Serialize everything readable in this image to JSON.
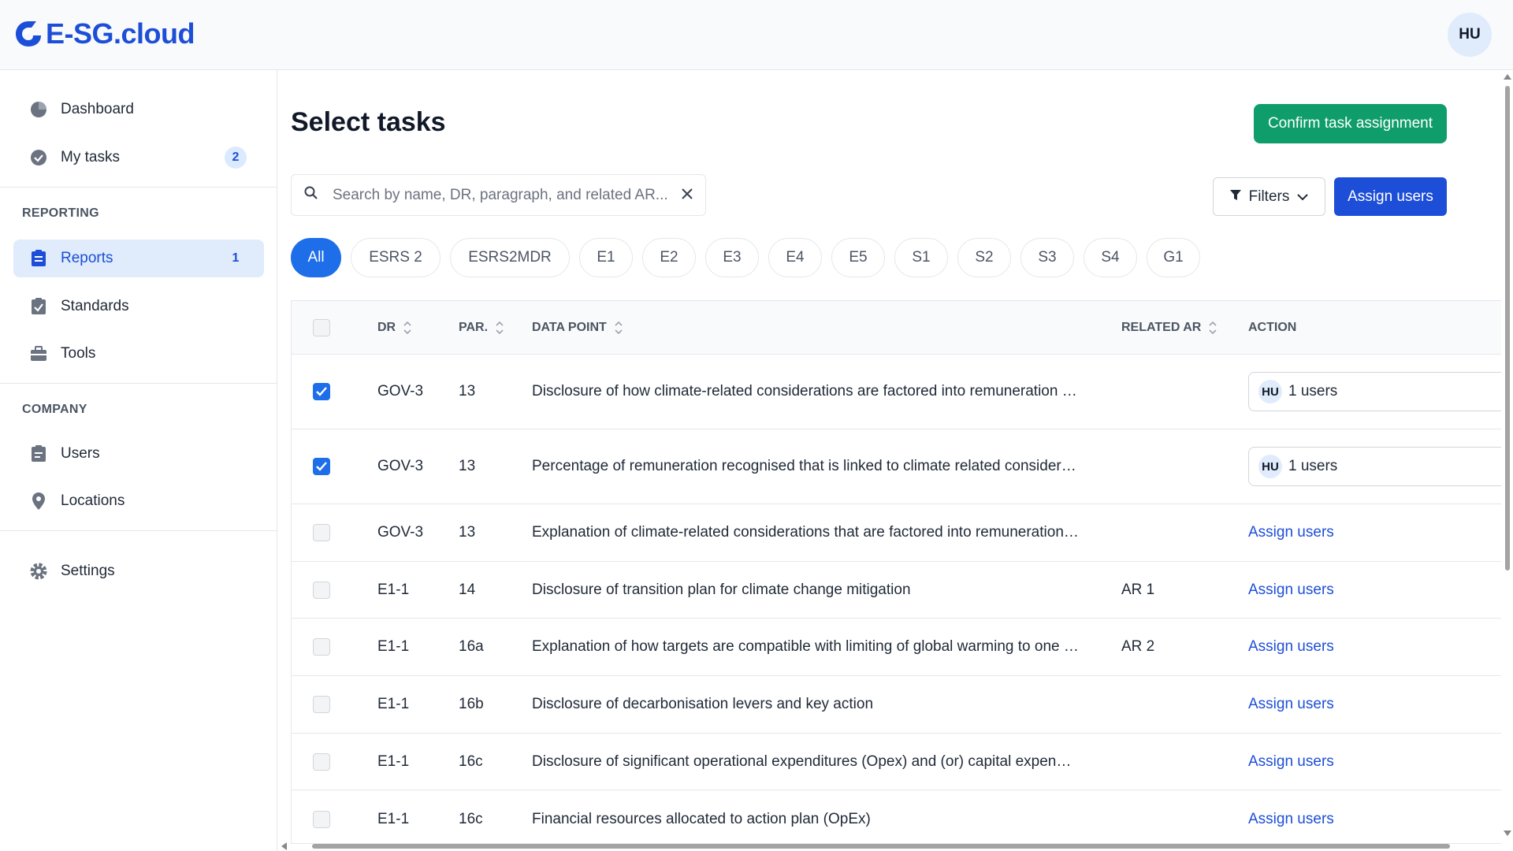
{
  "header": {
    "logo_text": "E-SG.cloud",
    "avatar_initials": "HU"
  },
  "sidebar": {
    "items": [
      {
        "label": "Dashboard",
        "icon": "pie-chart-icon"
      },
      {
        "label": "My tasks",
        "icon": "check-circle-icon",
        "badge": "2"
      }
    ],
    "reporting_title": "REPORTING",
    "reporting_items": [
      {
        "label": "Reports",
        "icon": "clipboard-icon",
        "badge": "1",
        "active": true
      },
      {
        "label": "Standards",
        "icon": "clipboard-check-icon"
      },
      {
        "label": "Tools",
        "icon": "briefcase-icon"
      }
    ],
    "company_title": "COMPANY",
    "company_items": [
      {
        "label": "Users",
        "icon": "user-list-icon"
      },
      {
        "label": "Locations",
        "icon": "map-pin-icon"
      }
    ],
    "settings_label": "Settings"
  },
  "main": {
    "title": "Select tasks",
    "confirm_button": "Confirm task assignment",
    "search_placeholder": "Search by name, DR, paragraph, and related AR...",
    "filters_button": "Filters",
    "assign_users_button": "Assign users",
    "chips": [
      "All",
      "ESRS 2",
      "ESRS2MDR",
      "E1",
      "E2",
      "E3",
      "E4",
      "E5",
      "S1",
      "S2",
      "S3",
      "S4",
      "G1"
    ],
    "active_chip": "All"
  },
  "table": {
    "columns": {
      "dr": "DR",
      "par": "PAR.",
      "data_point": "DATA POINT",
      "related_ar": "RELATED AR",
      "action": "ACTION"
    },
    "rows": [
      {
        "checked": true,
        "dr": "GOV-3",
        "par": "13",
        "data_point": "Disclosure of how climate-related considerations are factored into remuneration …",
        "related_ar": "",
        "action": "1 users",
        "action_type": "select"
      },
      {
        "checked": true,
        "dr": "GOV-3",
        "par": "13",
        "data_point": "Percentage of remuneration recognised that is linked to climate related consider…",
        "related_ar": "",
        "action": "1 users",
        "action_type": "select"
      },
      {
        "checked": false,
        "dr": "GOV-3",
        "par": "13",
        "data_point": "Explanation of climate-related considerations that are factored into remuneration…",
        "related_ar": "",
        "action": "Assign users",
        "action_type": "link"
      },
      {
        "checked": false,
        "dr": "E1-1",
        "par": "14",
        "data_point": "Disclosure of transition plan for climate change mitigation",
        "related_ar": "AR 1",
        "action": "Assign users",
        "action_type": "link"
      },
      {
        "checked": false,
        "dr": "E1-1",
        "par": "16a",
        "data_point": "Explanation of how targets are compatible with limiting of global warming to one …",
        "related_ar": "AR 2",
        "action": "Assign users",
        "action_type": "link"
      },
      {
        "checked": false,
        "dr": "E1-1",
        "par": "16b",
        "data_point": "Disclosure of decarbonisation levers and key action",
        "related_ar": "",
        "action": "Assign users",
        "action_type": "link"
      },
      {
        "checked": false,
        "dr": "E1-1",
        "par": "16c",
        "data_point": "Disclosure of significant operational expenditures (Opex) and (or) capital expen…",
        "related_ar": "",
        "action": "Assign users",
        "action_type": "link"
      },
      {
        "checked": false,
        "dr": "E1-1",
        "par": "16c",
        "data_point": "Financial resources allocated to action plan (OpEx)",
        "related_ar": "",
        "action": "Assign users",
        "action_type": "link"
      }
    ],
    "user_initials": "HU"
  },
  "colors": {
    "primary": "#1d4ed8",
    "green": "#0f9d6b",
    "chip_active": "#1d6ee8"
  }
}
